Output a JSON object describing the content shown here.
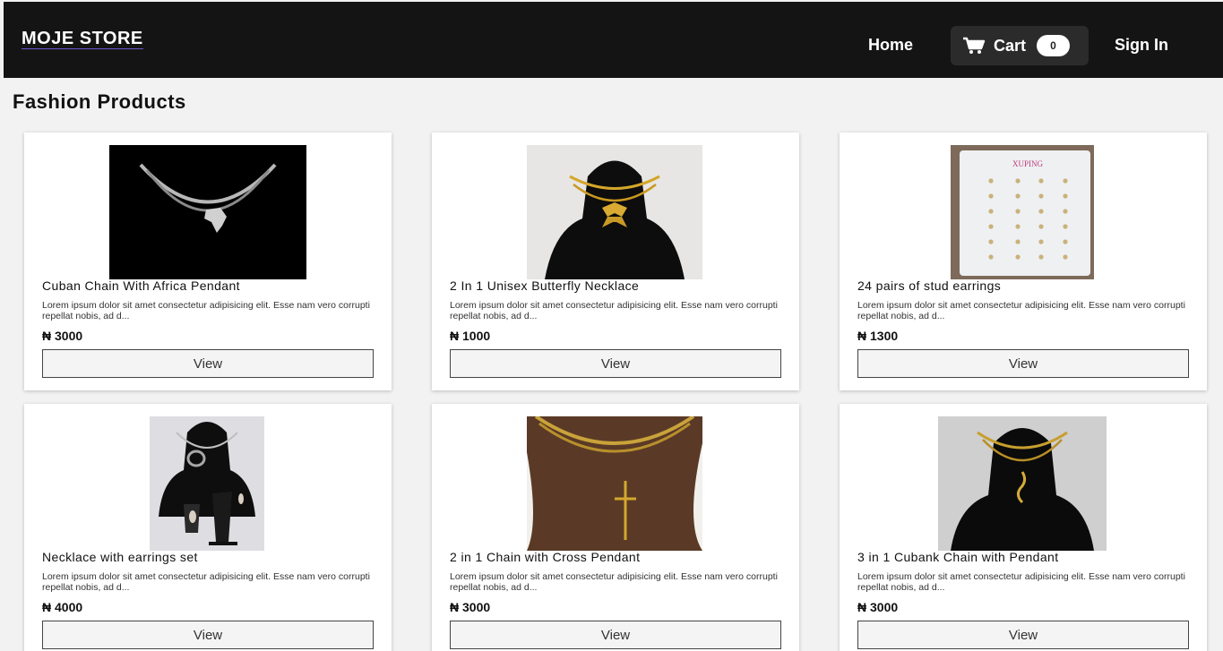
{
  "navbar": {
    "brand": "MOJE STORE",
    "home": "Home",
    "cart_label": "Cart",
    "cart_count": "0",
    "sign_in": "Sign In",
    "cart_icon": "shopping-cart-icon"
  },
  "page": {
    "title": "Fashion Products"
  },
  "products": [
    {
      "name": "Cuban Chain With Africa Pendant",
      "description": "Lorem ipsum dolor sit amet consectetur adipisicing elit. Esse nam vero corrupti repellat nobis, ad d...",
      "price": "₦ 3000",
      "button": "View"
    },
    {
      "name": "2 In 1 Unisex Butterfly Necklace",
      "description": "Lorem ipsum dolor sit amet consectetur adipisicing elit. Esse nam vero corrupti repellat nobis, ad d...",
      "price": "₦ 1000",
      "button": "View"
    },
    {
      "name": "24 pairs of stud earrings",
      "description": "Lorem ipsum dolor sit amet consectetur adipisicing elit. Esse nam vero corrupti repellat nobis, ad d...",
      "price": "₦ 1300",
      "button": "View",
      "image_text": "XUPING"
    },
    {
      "name": "Necklace with earrings set",
      "description": "Lorem ipsum dolor sit amet consectetur adipisicing elit. Esse nam vero corrupti repellat nobis, ad d...",
      "price": "₦ 4000",
      "button": "View"
    },
    {
      "name": "2 in 1 Chain with Cross Pendant",
      "description": "Lorem ipsum dolor sit amet consectetur adipisicing elit. Esse nam vero corrupti repellat nobis, ad d...",
      "price": "₦ 3000",
      "button": "View"
    },
    {
      "name": "3 in 1 Cubank Chain with Pendant",
      "description": "Lorem ipsum dolor sit amet consectetur adipisicing elit. Esse nam vero corrupti repellat nobis, ad d...",
      "price": "₦ 3000",
      "button": "View"
    }
  ],
  "colors": {
    "navbar": "#141414",
    "background": "#f2f2f2",
    "card": "#ffffff",
    "accent_underline": "#6a5acd"
  }
}
